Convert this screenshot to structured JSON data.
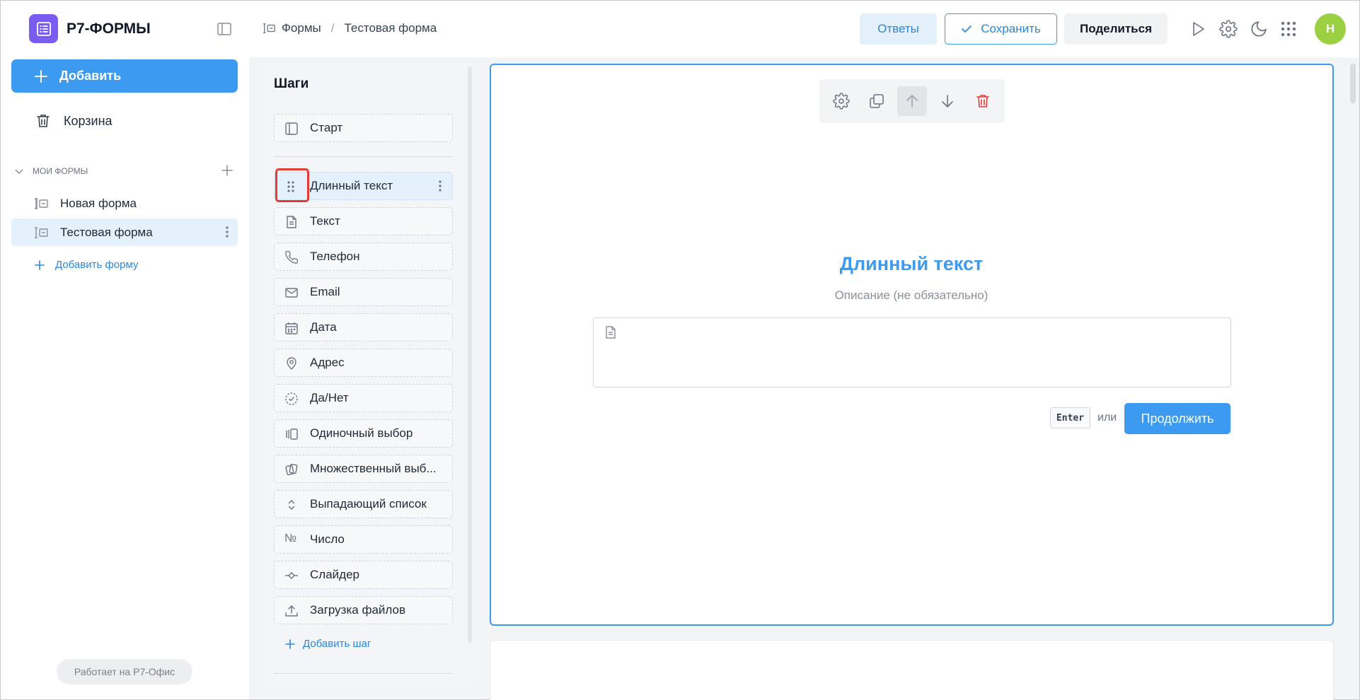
{
  "app": {
    "name": "Р7-ФОРМЫ"
  },
  "sidebar": {
    "add_label": "Добавить",
    "trash_label": "Корзина",
    "section_label": "МОИ ФОРМЫ",
    "forms": [
      {
        "label": "Новая форма"
      },
      {
        "label": "Тестовая форма"
      }
    ],
    "add_form_label": "Добавить форму",
    "powered_by": "Работает на Р7-Офис"
  },
  "breadcrumb": {
    "root": "Формы",
    "separator": "/",
    "current": "Тестовая форма"
  },
  "header": {
    "answers_label": "Ответы",
    "save_label": "Сохранить",
    "share_label": "Поделиться",
    "avatar_initial": "Н"
  },
  "steps": {
    "title": "Шаги",
    "start_label": "Старт",
    "items": [
      {
        "label": "Длинный текст",
        "icon": "drag-handle-icon"
      },
      {
        "label": "Текст",
        "icon": "document-icon"
      },
      {
        "label": "Телефон",
        "icon": "phone-icon"
      },
      {
        "label": "Email",
        "icon": "mail-icon"
      },
      {
        "label": "Дата",
        "icon": "calendar-icon"
      },
      {
        "label": "Адрес",
        "icon": "location-icon"
      },
      {
        "label": "Да/Нет",
        "icon": "check-circle-icon"
      },
      {
        "label": "Одиночный выбор",
        "icon": "single-choice-icon"
      },
      {
        "label": "Множественный выб...",
        "icon": "multi-choice-icon"
      },
      {
        "label": "Выпадающий список",
        "icon": "chevron-up-down-icon"
      },
      {
        "label": "Число",
        "icon": "numero-icon",
        "glyph": "№"
      },
      {
        "label": "Слайдер",
        "icon": "slider-icon"
      },
      {
        "label": "Загрузка файлов",
        "icon": "upload-icon"
      }
    ],
    "add_step_label": "Добавить шаг"
  },
  "question": {
    "title": "Длинный текст",
    "description": "Описание (не обязательно)",
    "enter_key": "Enter",
    "or_label": "или",
    "continue_label": "Продолжить"
  },
  "colors": {
    "accent": "#3c9bf0",
    "brand": "#7b5cf0",
    "danger": "#e53935",
    "avatar": "#9bd043"
  }
}
